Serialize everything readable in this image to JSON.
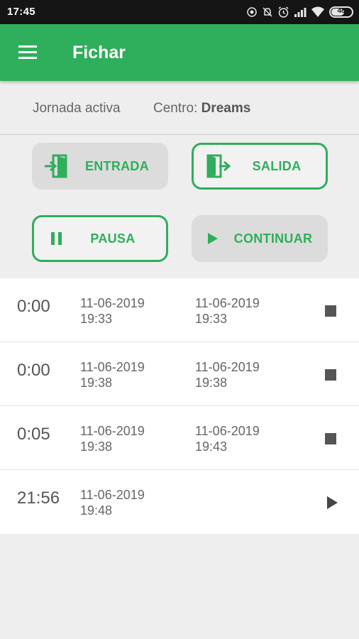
{
  "status_bar": {
    "time": "17:45",
    "battery": "48",
    "icons": [
      "location-icon",
      "alarm-off-icon",
      "alarm-icon",
      "signal-icon",
      "wifi-icon",
      "battery-icon"
    ]
  },
  "app_bar": {
    "title": "Fichar",
    "menu_icon": "menu-icon",
    "color": "#2fae5b"
  },
  "info": {
    "jornada": "Jornada activa",
    "centro_label": "Centro:",
    "centro_value": "Dreams"
  },
  "buttons": {
    "entrada": {
      "label": "ENTRADA",
      "icon": "enter-door-icon"
    },
    "salida": {
      "label": "SALIDA",
      "icon": "exit-door-icon"
    },
    "pausa": {
      "label": "PAUSA",
      "icon": "pause-icon"
    },
    "continuar": {
      "label": "CONTINUAR",
      "icon": "play-icon"
    }
  },
  "entries": [
    {
      "duration": "0:00",
      "start_date": "11-06-2019",
      "start_time": "19:33",
      "end_date": "11-06-2019",
      "end_time": "19:33",
      "action": "stop-icon"
    },
    {
      "duration": "0:00",
      "start_date": "11-06-2019",
      "start_time": "19:38",
      "end_date": "11-06-2019",
      "end_time": "19:38",
      "action": "stop-icon"
    },
    {
      "duration": "0:05",
      "start_date": "11-06-2019",
      "start_time": "19:38",
      "end_date": "11-06-2019",
      "end_time": "19:43",
      "action": "stop-icon"
    },
    {
      "duration": "21:56",
      "start_date": "11-06-2019",
      "start_time": "19:48",
      "end_date": "",
      "end_time": "",
      "action": "play-icon"
    }
  ]
}
